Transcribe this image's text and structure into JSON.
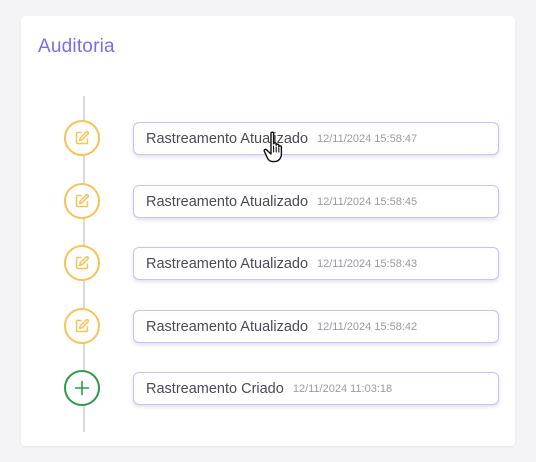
{
  "panel": {
    "title": "Auditoria"
  },
  "entries": [
    {
      "label": "Rastreamento Atualizado",
      "timestamp": "12/11/2024 15:58:47",
      "icon": "edit-icon"
    },
    {
      "label": "Rastreamento Atualizado",
      "timestamp": "12/11/2024 15:58:45",
      "icon": "edit-icon"
    },
    {
      "label": "Rastreamento Atualizado",
      "timestamp": "12/11/2024 15:58:43",
      "icon": "edit-icon"
    },
    {
      "label": "Rastreamento Atualizado",
      "timestamp": "12/11/2024 15:58:42",
      "icon": "edit-icon"
    },
    {
      "label": "Rastreamento Criado",
      "timestamp": "12/11/2024 11:03:18",
      "icon": "plus-icon"
    }
  ],
  "colors": {
    "title": "#7b6ee6",
    "edit_accent": "#f4c35a",
    "create_accent": "#2e9a4a",
    "bubble_border": "#c9c4ee"
  }
}
